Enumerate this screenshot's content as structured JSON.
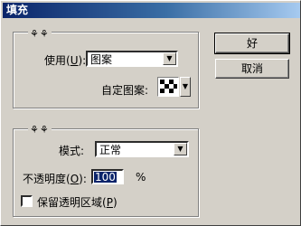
{
  "window": {
    "title": "填充"
  },
  "buttons": {
    "ok": "好",
    "cancel": "取消"
  },
  "contents": {
    "use_label": "使用",
    "use_hotkey": "U",
    "use_value": "图案",
    "custom_pattern_label": "自定图案:"
  },
  "blending": {
    "mode_label": "模式:",
    "mode_value": "正常",
    "opacity_label": "不透明度",
    "opacity_hotkey": "O",
    "opacity_value": "100",
    "opacity_unit": "%",
    "preserve_label": "保留透明区域",
    "preserve_hotkey": "P",
    "preserve_checked": false
  },
  "colors": {
    "titlebar_start": "#0a246a",
    "face": "#d4d0c8"
  },
  "icons": {
    "dropdown": "chevron-down-icon",
    "grip": "group-grip-icon"
  }
}
